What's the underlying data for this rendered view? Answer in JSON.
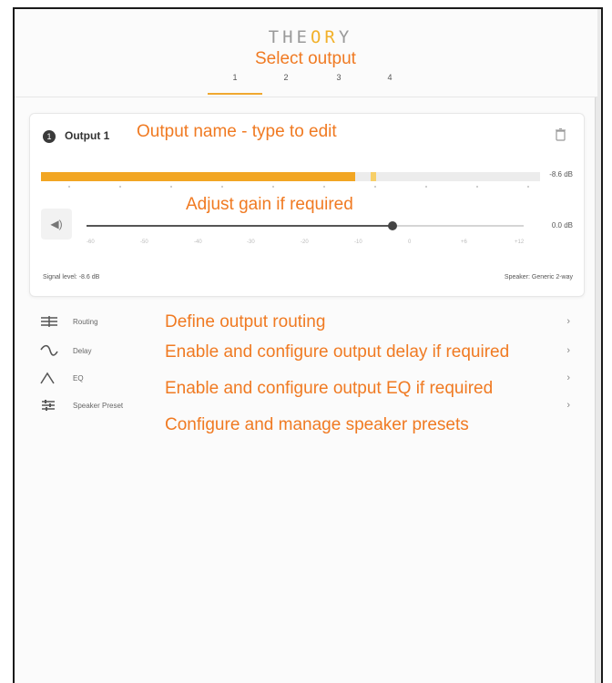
{
  "app": {
    "logo_prefix": "THE",
    "logo_accent": "OR",
    "logo_suffix": "Y"
  },
  "tabs": [
    {
      "label": "1",
      "active": true
    },
    {
      "label": "2",
      "active": false
    },
    {
      "label": "3",
      "active": false
    },
    {
      "label": "4",
      "active": false
    }
  ],
  "output": {
    "number": "1",
    "name": "Output 1",
    "meter_value": "-8.6 dB",
    "meter_level": 0.63,
    "meter_peak": 0.66,
    "gain_value": "0.0 dB",
    "gain_level": 0.7,
    "gain_ticks": [
      "-60",
      "-50",
      "-40",
      "-30",
      "-20",
      "-10",
      "0",
      "+6",
      "+12"
    ],
    "footer_left": "Signal level: -8.6 dB",
    "footer_right": "Speaker: Generic 2-way"
  },
  "menu": [
    {
      "label": "Routing",
      "icon": "routing-icon"
    },
    {
      "label": "Delay",
      "icon": "delay-icon"
    },
    {
      "label": "EQ",
      "icon": "eq-icon"
    },
    {
      "label": "Speaker Preset",
      "icon": "speaker-preset-icon"
    }
  ],
  "annotations": {
    "select_output": "Select output",
    "output_name": "Output name - type to edit",
    "adjust_gain": "Adjust gain if required",
    "routing": "Define output routing",
    "delay": "Enable and configure output delay if required",
    "eq": "Enable and configure output EQ if required",
    "speaker_presets": "Configure and manage speaker presets"
  },
  "colors": {
    "accent": "#f2a623",
    "annotation": "#f07a22"
  }
}
